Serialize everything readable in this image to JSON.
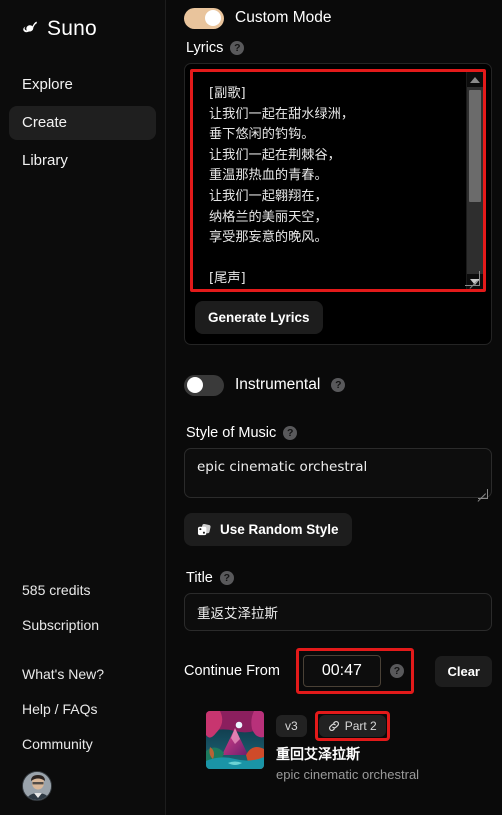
{
  "sidebar": {
    "brand": "Suno",
    "nav": [
      {
        "label": "Explore",
        "active": false
      },
      {
        "label": "Create",
        "active": true
      },
      {
        "label": "Library",
        "active": false
      }
    ],
    "footer": [
      "585 credits",
      "Subscription",
      "What's New?",
      "Help / FAQs",
      "Community"
    ]
  },
  "main": {
    "custom_mode": {
      "label": "Custom Mode",
      "state": "on"
    },
    "lyrics": {
      "label": "Lyrics",
      "help": "?",
      "value": "[副歌]\n让我们一起在甜水绿洲，\n垂下悠闲的钓钩。\n让我们一起在荆棘谷，\n重温那热血的青春。\n让我们一起翱翔在，\n纳格兰的美丽天空，\n享受那妄意的晚风。\n\n[尾声]\n为了部落，为了联盟，为了那份执着。",
      "generate_button": "Generate Lyrics"
    },
    "instrumental": {
      "label": "Instrumental",
      "help": "?",
      "state": "off"
    },
    "style_of_music": {
      "label": "Style of Music",
      "help": "?",
      "value": "epic cinematic orchestral",
      "random_button": "Use Random Style",
      "random_icon": "dice-icon"
    },
    "title": {
      "label": "Title",
      "help": "?",
      "value": "重返艾泽拉斯"
    },
    "continue_from": {
      "label": "Continue From",
      "value": "00:47",
      "help": "?",
      "clear_button": "Clear"
    },
    "song_card": {
      "version_badge": "v3",
      "part_badge": "Part 2",
      "part_icon": "link-icon",
      "title": "重回艾泽拉斯",
      "style": "epic cinematic orchestral"
    }
  },
  "colors": {
    "accent_toggle": "#e9c49c",
    "highlight": "#e31a1a",
    "background": "#0a0a0a",
    "panel": "#1d1d1d"
  }
}
